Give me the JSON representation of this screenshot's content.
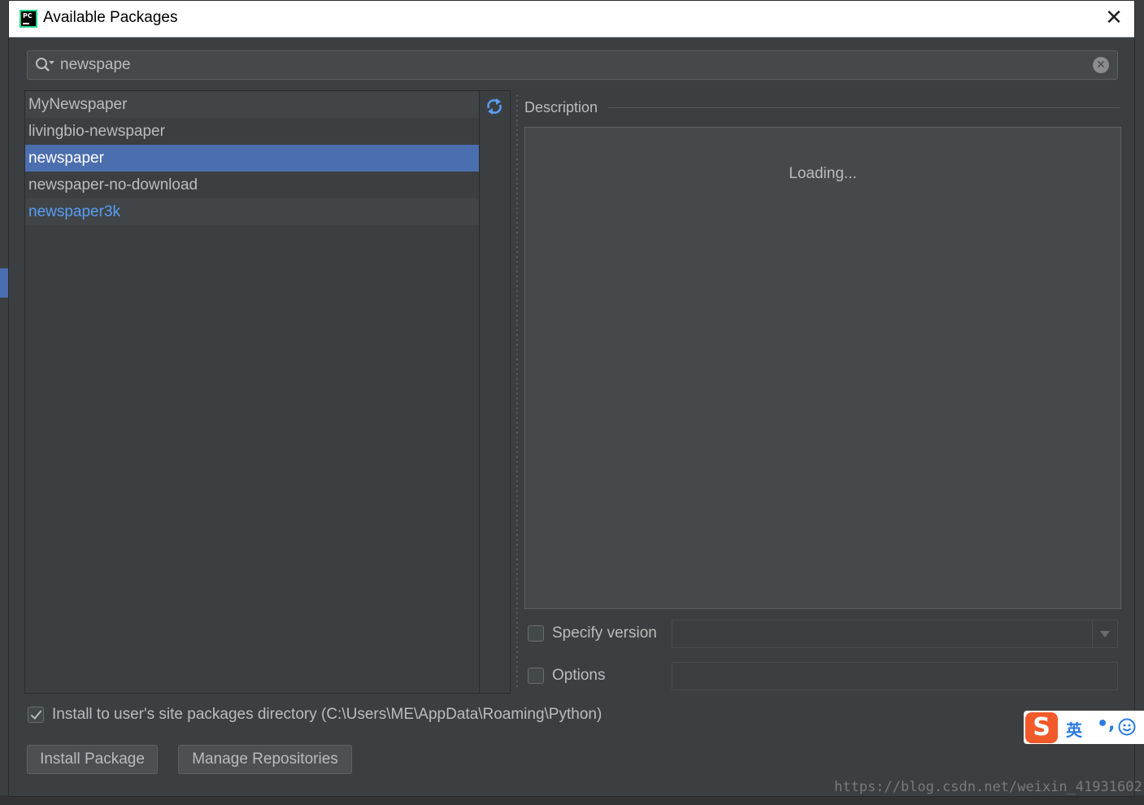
{
  "window": {
    "title": "Available Packages"
  },
  "search": {
    "value": "newspape"
  },
  "packages": [
    {
      "name": "MyNewspaper",
      "state": "normal"
    },
    {
      "name": "livingbio-newspaper",
      "state": "normal"
    },
    {
      "name": "newspaper",
      "state": "selected"
    },
    {
      "name": "newspaper-no-download",
      "state": "normal"
    },
    {
      "name": "newspaper3k",
      "state": "installed"
    }
  ],
  "description": {
    "label": "Description",
    "status": "Loading..."
  },
  "specify_version": {
    "label": "Specify version",
    "checked": false,
    "value": ""
  },
  "options": {
    "label": "Options",
    "checked": false,
    "value": ""
  },
  "install_to_user": {
    "label": "Install to user's site packages directory (C:\\Users\\ME\\AppData\\Roaming\\Python)",
    "checked": true
  },
  "buttons": {
    "install": "Install Package",
    "manage_repos": "Manage Repositories"
  },
  "ime": {
    "logo": "S",
    "mode": "英",
    "punctuation": "•,"
  },
  "watermark": "https://blog.csdn.net/weixin_41931602",
  "colors": {
    "selection": "#4b6eaf",
    "installed": "#589df6",
    "panel": "#3c3f41"
  }
}
